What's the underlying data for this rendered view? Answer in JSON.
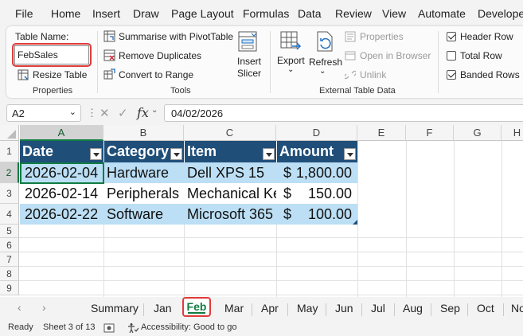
{
  "menu": [
    "File",
    "Home",
    "Insert",
    "Draw",
    "Page Layout",
    "Formulas",
    "Data",
    "Review",
    "View",
    "Automate",
    "Developer"
  ],
  "ribbon": {
    "properties": {
      "table_name_label": "Table Name:",
      "table_name_value": "FebSales",
      "resize_table": "Resize Table",
      "group_label": "Properties"
    },
    "tools": {
      "summarise_pivot": "Summarise with PivotTable",
      "remove_duplicates": "Remove Duplicates",
      "convert_to_range": "Convert to Range",
      "insert_slicer_line1": "Insert",
      "insert_slicer_line2": "Slicer",
      "group_label": "Tools"
    },
    "external": {
      "export": "Export",
      "refresh": "Refresh",
      "properties": "Properties",
      "open_in_browser": "Open in Browser",
      "unlink": "Unlink",
      "group_label": "External Table Data"
    },
    "style_options": {
      "header_row": {
        "label": "Header Row",
        "checked": true
      },
      "total_row": {
        "label": "Total Row",
        "checked": false
      },
      "banded_rows": {
        "label": "Banded Rows",
        "checked": true
      }
    }
  },
  "formula_bar": {
    "name_box": "A2",
    "fx": "fx",
    "value": "04/02/2026"
  },
  "sheet": {
    "columns": [
      "A",
      "B",
      "C",
      "D",
      "E",
      "F",
      "G",
      "H"
    ],
    "rows": [
      "1",
      "2",
      "3",
      "4",
      "5",
      "6",
      "7",
      "8",
      "9"
    ],
    "selected_column": "A",
    "selected_row": "2",
    "table": {
      "headers": [
        "Date",
        "Category",
        "Item",
        "Amount"
      ],
      "rows": [
        {
          "date": "2026-02-04",
          "category": "Hardware",
          "item": "Dell XPS 15",
          "currency": "$",
          "amount": "1,800.00"
        },
        {
          "date": "2026-02-14",
          "category": "Peripherals",
          "item": "Mechanical Keyboard",
          "currency": "$",
          "amount": "150.00"
        },
        {
          "date": "2026-02-22",
          "category": "Software",
          "item": "Microsoft 365",
          "currency": "$",
          "amount": "100.00"
        }
      ],
      "header_color": "#1f4e79",
      "band_color": "#bcdff5"
    }
  },
  "tabs": {
    "items": [
      "Summary",
      "Jan",
      "Feb",
      "Mar",
      "Apr",
      "May",
      "Jun",
      "Jul",
      "Aug",
      "Sep",
      "Oct",
      "No"
    ],
    "active": "Feb"
  },
  "status": {
    "ready": "Ready",
    "sheet_info": "Sheet 3 of 13",
    "accessibility": "Accessibility: Good to go"
  }
}
